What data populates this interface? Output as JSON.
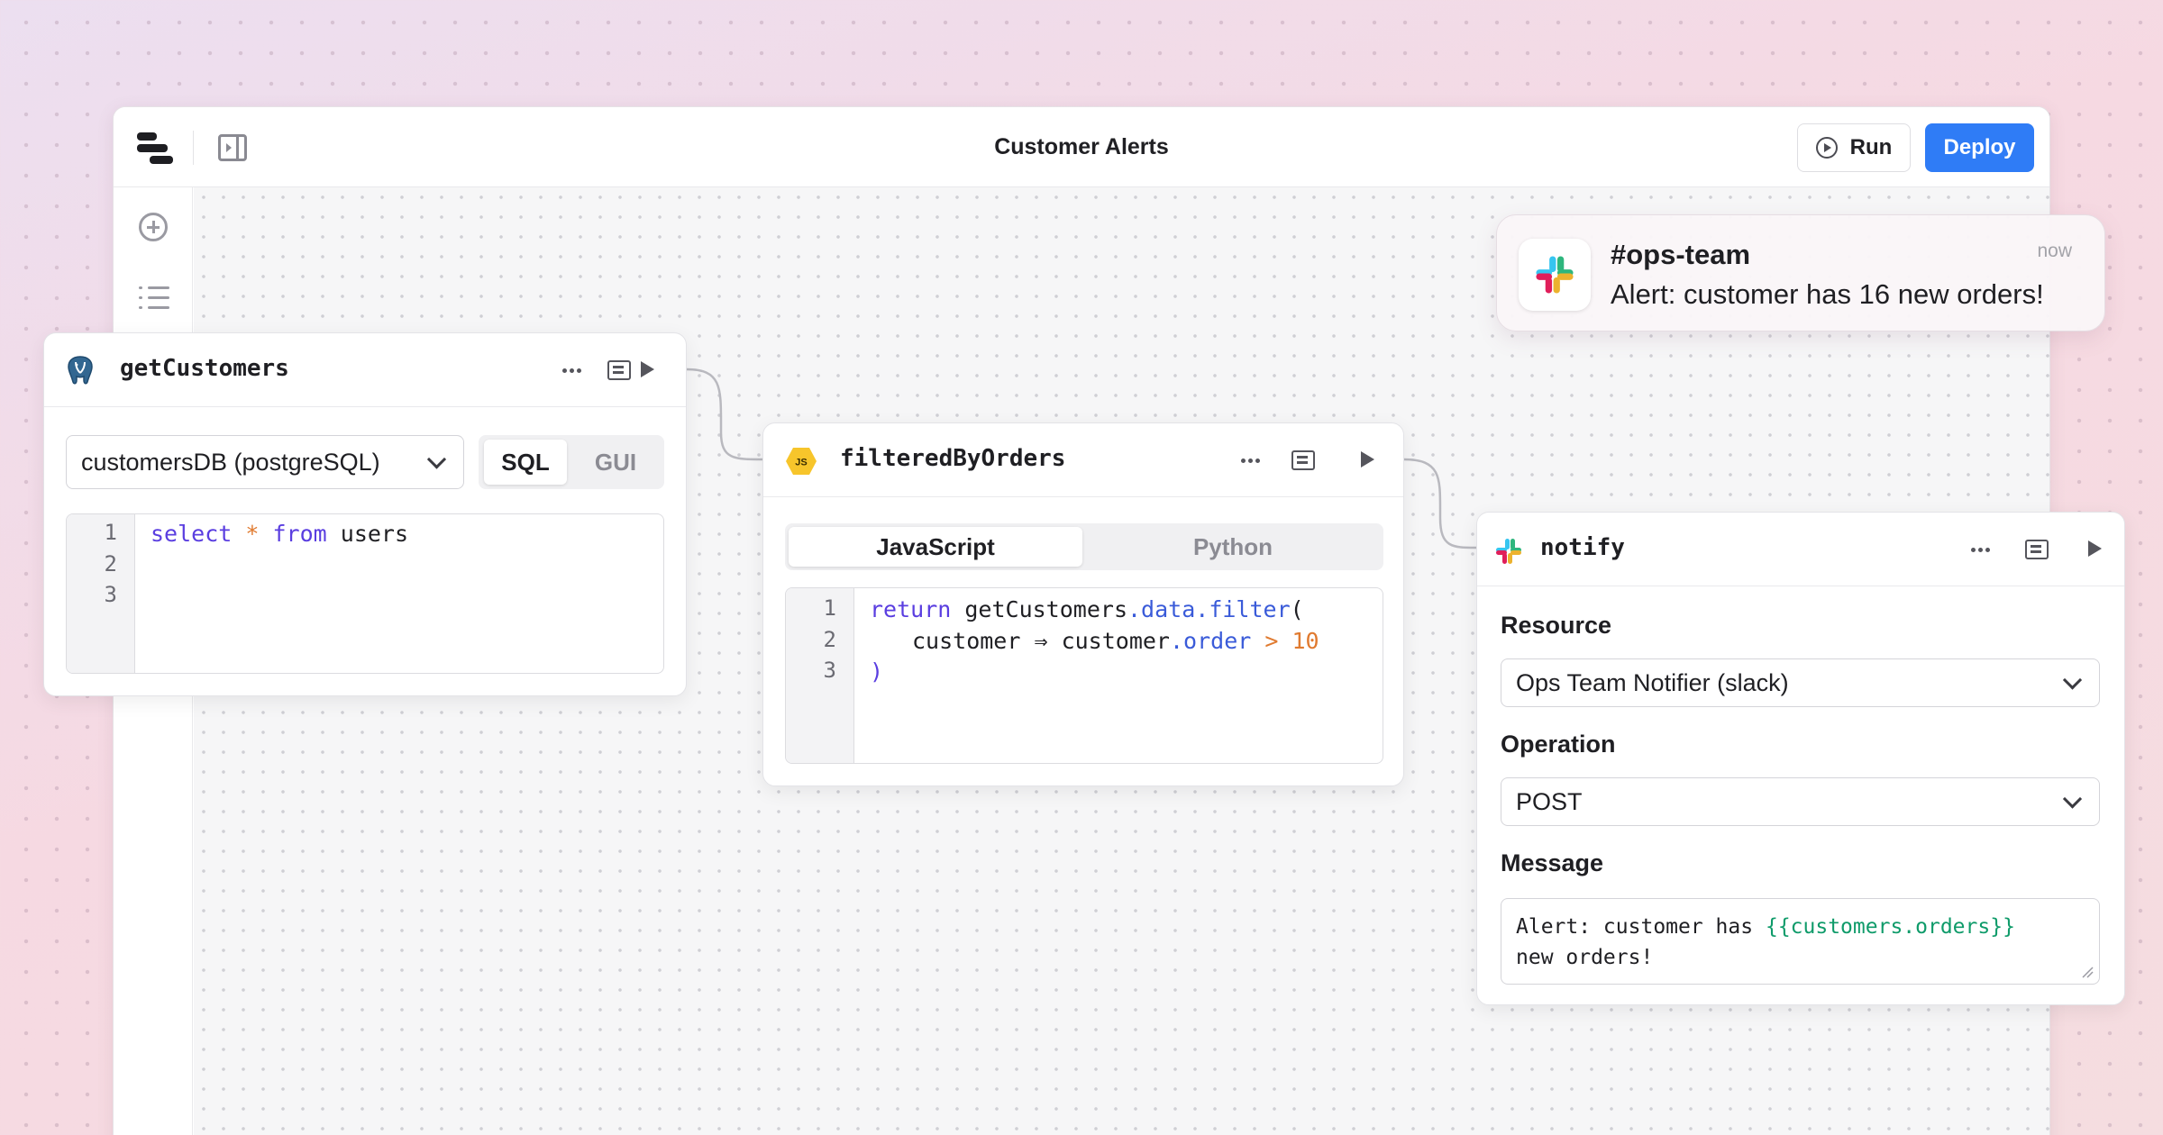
{
  "window": {
    "title": "Customer Alerts",
    "run_label": "Run",
    "deploy_label": "Deploy"
  },
  "nodes": {
    "get_customers": {
      "name": "getCustomers",
      "resource": "customersDB (postgreSQL)",
      "modes": [
        "SQL",
        "GUI"
      ],
      "active_mode": "SQL",
      "line_numbers": [
        "1",
        "2",
        "3"
      ],
      "code": {
        "kw1": "select",
        "op1": "*",
        "kw2": "from",
        "ident": "users"
      }
    },
    "filtered_by_orders": {
      "name": "filteredByOrders",
      "badge": "JS",
      "languages": [
        "JavaScript",
        "Python"
      ],
      "active_language": "JavaScript",
      "line_numbers": [
        "1",
        "2",
        "3"
      ],
      "code": {
        "l1_kw": "return",
        "l1_ident": "getCustomers",
        "l1_prop1": ".data",
        "l1_prop2": ".filter",
        "l1_paren": "(",
        "l2_ident": "customer ⇒ customer",
        "l2_prop": ".order",
        "l2_op": ">",
        "l2_num": "10",
        "l3_paren": ")"
      }
    },
    "notify": {
      "name": "notify",
      "resource_label": "Resource",
      "resource_value": "Ops Team Notifier (slack)",
      "operation_label": "Operation",
      "operation_value": "POST",
      "message_label": "Message",
      "message_prefix": "Alert: customer has",
      "message_template": "{{customers.orders}}",
      "message_suffix": "new orders!"
    }
  },
  "notification": {
    "channel": "#ops-team",
    "message": "Alert: customer has 16 new orders!",
    "time": "now"
  },
  "colors": {
    "accent": "#2f7cf6",
    "keyword": "#5a3ee0",
    "operator": "#e07a2f",
    "property": "#3a5bd9",
    "template": "#0f9b6a"
  },
  "icons": [
    "logo-icon",
    "panel-toggle-icon",
    "play-circle-icon",
    "add-icon",
    "list-icon",
    "postgres-icon",
    "more-icon",
    "logs-icon",
    "play-icon",
    "js-icon",
    "slack-icon",
    "chevron-down-icon"
  ]
}
